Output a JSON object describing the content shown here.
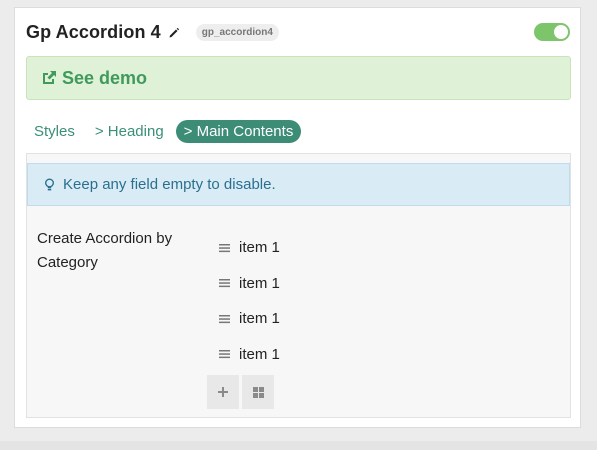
{
  "header": {
    "title": "Gp Accordion 4",
    "slug": "gp_accordion4",
    "enabled": true
  },
  "demo": {
    "label": "See demo",
    "icon": "external-link-icon"
  },
  "tabs": [
    {
      "label": "Styles",
      "active": false
    },
    {
      "label": "> Heading",
      "active": false
    },
    {
      "label": "> Main Contents",
      "active": true
    }
  ],
  "notice": {
    "text": "Keep any field empty to disable.",
    "icon": "lightbulb-icon"
  },
  "field": {
    "label": "Create Accordion by Category",
    "items": [
      "item 1",
      "item 1",
      "item 1",
      "item 1"
    ]
  },
  "colors": {
    "accent": "#3c8c76",
    "toggle_on": "#7cc56a",
    "demo_bg": "#dff1d6",
    "notice_bg": "#d9ecf6"
  }
}
